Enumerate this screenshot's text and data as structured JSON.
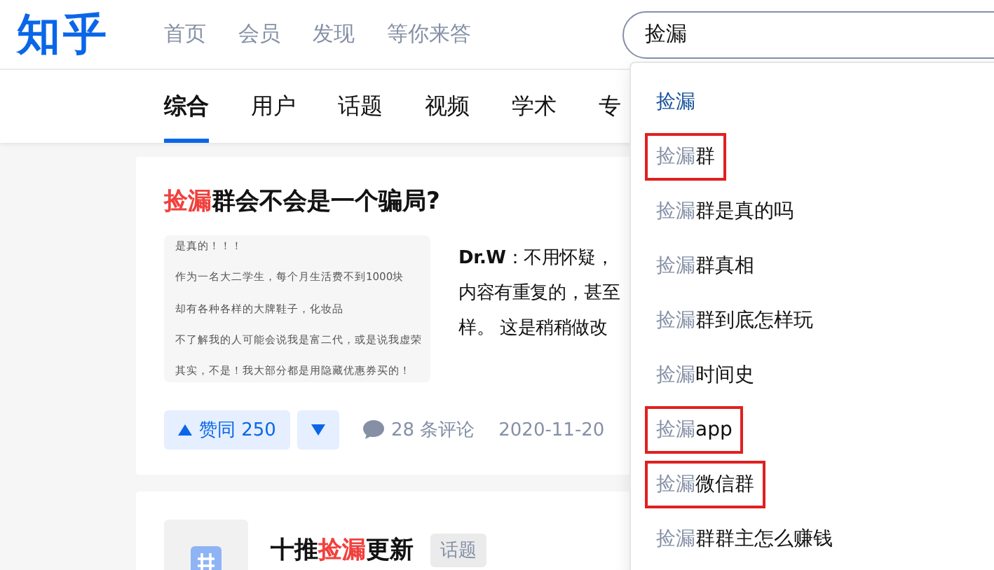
{
  "header": {
    "logo": "知乎",
    "nav": [
      {
        "label": "首页",
        "selected": false
      },
      {
        "label": "会员",
        "selected": false
      },
      {
        "label": "发现",
        "selected": false
      },
      {
        "label": "等你来答",
        "selected": false
      }
    ],
    "search": {
      "value": "捡漏"
    }
  },
  "tabs": [
    {
      "label": "综合",
      "selected": true
    },
    {
      "label": "用户",
      "selected": false
    },
    {
      "label": "话题",
      "selected": false
    },
    {
      "label": "视频",
      "selected": false
    },
    {
      "label": "学术",
      "selected": false
    },
    {
      "label": "专",
      "selected": false
    }
  ],
  "answer_card": {
    "title": [
      {
        "text": "捡漏",
        "highlight": true
      },
      {
        "text": "群会不会是一个骗局?",
        "highlight": false
      }
    ],
    "thumbnail_lines": [
      "是真的！！！",
      "作为一名大二学生，每个月生活费不到1000块",
      "却有各种各样的大牌鞋子，化妆品",
      "不了解我的人可能会说我是富二代，或是说我虚荣",
      "其实，不是！我大部分都是用隐藏优惠券买的！"
    ],
    "excerpt": {
      "author": "Dr.W",
      "lines": [
        "：不用怀疑，",
        "内容有重复的，甚至",
        "样。 这是稍稍做改"
      ]
    },
    "upvote": {
      "label": "赞同 250",
      "selected": false
    },
    "downvote": {
      "selected": false
    },
    "comments": "28 条评论",
    "date": "2020-11-20"
  },
  "topic_card": {
    "title": [
      {
        "text": "十推",
        "highlight": false
      },
      {
        "text": "捡漏",
        "highlight": true
      },
      {
        "text": "更新",
        "highlight": false
      }
    ],
    "tag": "话题"
  },
  "suggestions": [
    {
      "match": "捡漏",
      "selected": true,
      "marked": false
    },
    {
      "match": "捡漏",
      "rest": "群",
      "selected": false,
      "marked": true
    },
    {
      "match": "捡漏",
      "rest": "群是真的吗",
      "selected": false,
      "marked": false
    },
    {
      "match": "捡漏",
      "rest": "群真相",
      "selected": false,
      "marked": false
    },
    {
      "match": "捡漏",
      "rest": "群到底怎样玩",
      "selected": false,
      "marked": false
    },
    {
      "match": "捡漏",
      "rest": "时间史",
      "selected": false,
      "marked": false
    },
    {
      "match": "捡漏",
      "rest": "app",
      "selected": false,
      "marked": true
    },
    {
      "match": "捡漏",
      "rest": "微信群",
      "selected": false,
      "marked": true
    },
    {
      "match": "捡漏",
      "rest": "群群主怎么赚钱",
      "selected": false,
      "marked": false
    }
  ]
}
